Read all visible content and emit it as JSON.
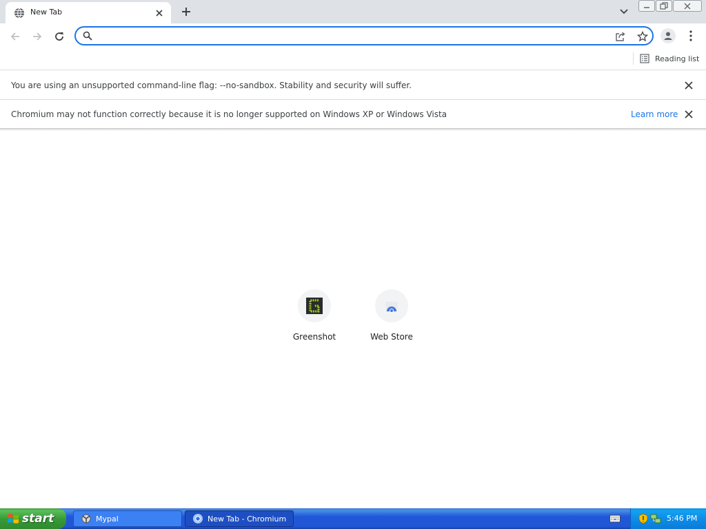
{
  "tab": {
    "title": "New Tab",
    "close_label": "×"
  },
  "window": {
    "minimize": "–",
    "maximize": "❐",
    "close": "✕"
  },
  "omnibox": {
    "value": "",
    "placeholder": ""
  },
  "bookmarks": {
    "reading_list_label": "Reading list"
  },
  "infobars": [
    {
      "text": "You are using an unsupported command-line flag: --no-sandbox. Stability and security will suffer.",
      "link": ""
    },
    {
      "text": "Chromium may not function correctly because it is no longer supported on Windows XP or Windows Vista",
      "link": "Learn more"
    }
  ],
  "shortcuts": [
    {
      "label": "Greenshot",
      "icon": "greenshot-icon"
    },
    {
      "label": "Web Store",
      "icon": "web-store-icon"
    }
  ],
  "taskbar": {
    "start_label": "start",
    "tasks": [
      {
        "label": "Mypal",
        "icon": "mypal-icon",
        "active": false
      },
      {
        "label": "New Tab - Chromium",
        "icon": "chromium-icon",
        "active": true
      }
    ],
    "clock": "5:46 PM"
  },
  "colors": {
    "accent": "#1a73e8",
    "tabstrip": "#dee1e6",
    "taskbar": "#2157d7",
    "start": "#379b37"
  }
}
